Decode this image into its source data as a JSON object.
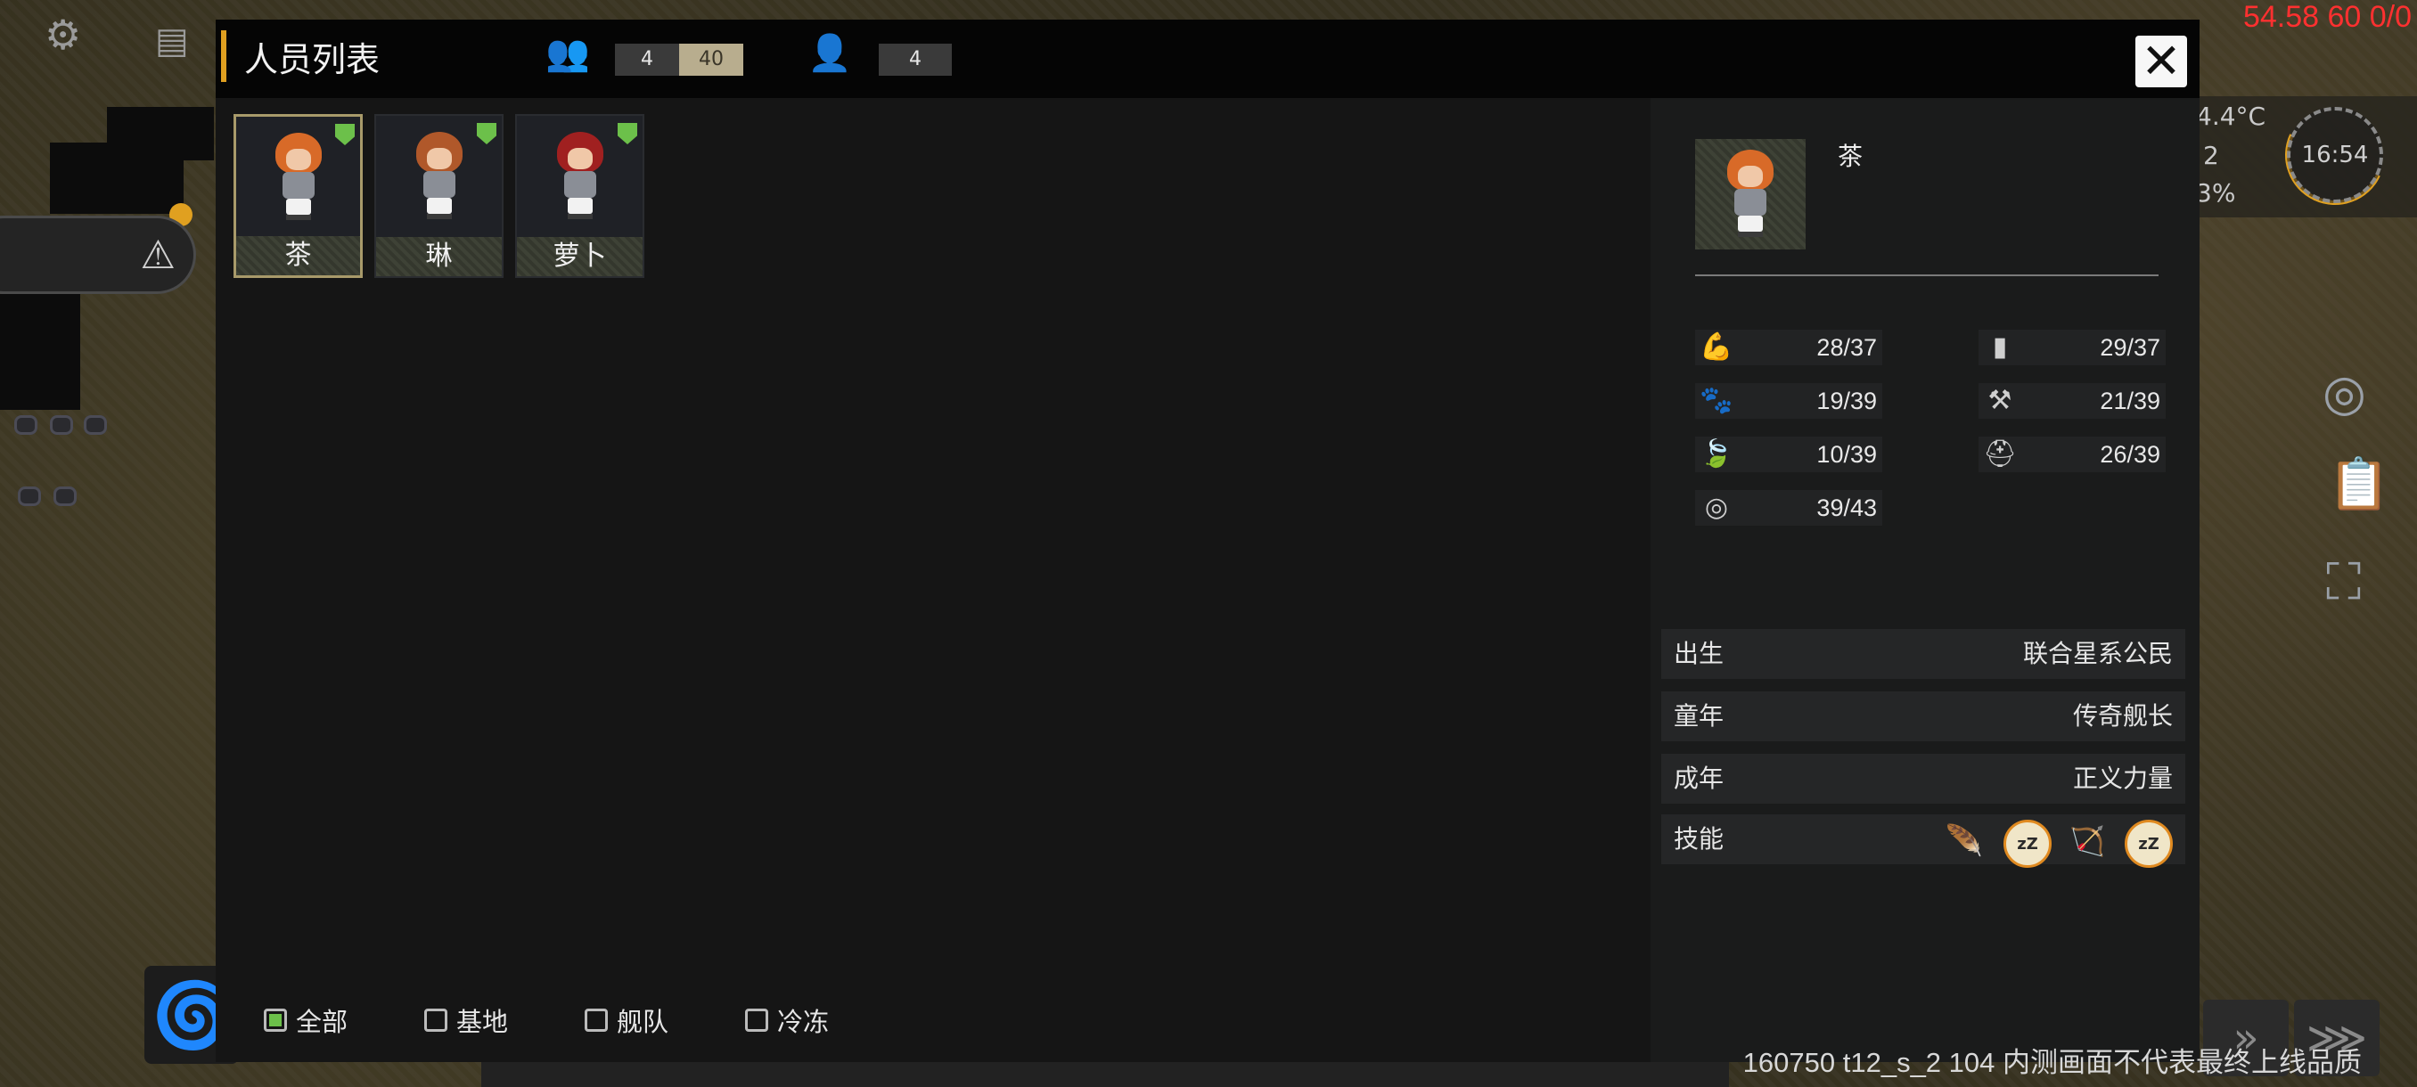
{
  "overlay": {
    "fps": "54.58 60 0/0",
    "temperature": "4.4°C",
    "hud_line2": "2",
    "hud_line3": "3%",
    "clock": "16:54",
    "build_info": "160750 t12_s_2 104  内测画面不代表最终上线品质"
  },
  "header": {
    "title": "人员列表",
    "population_current": "4",
    "population_capacity": "40",
    "crew_count": "4",
    "icons": [
      "people-icon",
      "crew-member-icon"
    ]
  },
  "crew": [
    {
      "name": "茶",
      "hair_color": "#d86a28",
      "selected": true
    },
    {
      "name": "琳",
      "hair_color": "#b0582a",
      "selected": false
    },
    {
      "name": "萝卜",
      "hair_color": "#a02020",
      "selected": false
    }
  ],
  "filters": [
    {
      "label": "全部",
      "checked": true
    },
    {
      "label": "基地",
      "checked": false
    },
    {
      "label": "舰队",
      "checked": false
    },
    {
      "label": "冷冻",
      "checked": false
    }
  ],
  "detail": {
    "name": "茶",
    "attributes_left": [
      {
        "icon": "strength-arm-icon",
        "value": "28/37"
      },
      {
        "icon": "paw-icon",
        "value": "19/39"
      },
      {
        "icon": "leaf-icon",
        "value": "10/39"
      },
      {
        "icon": "target-icon",
        "value": "39/43"
      }
    ],
    "attributes_right": [
      {
        "icon": "book-icon",
        "value": "29/37"
      },
      {
        "icon": "tools-icon",
        "value": "21/39"
      },
      {
        "icon": "helmet-icon",
        "value": "26/39"
      }
    ],
    "info": [
      {
        "label": "出生",
        "value": "联合星系公民"
      },
      {
        "label": "童年",
        "value": "传奇舰长"
      },
      {
        "label": "成年",
        "value": "正义力量"
      }
    ],
    "skills_label": "技能",
    "skills": [
      "feather-up-icon",
      "sleep-zzz-icon",
      "bow-up-icon",
      "sleep-zzz-icon"
    ]
  },
  "colors": {
    "accent": "#e0a020",
    "shield_green": "#6cc04a",
    "fps_red": "#ff3030"
  }
}
